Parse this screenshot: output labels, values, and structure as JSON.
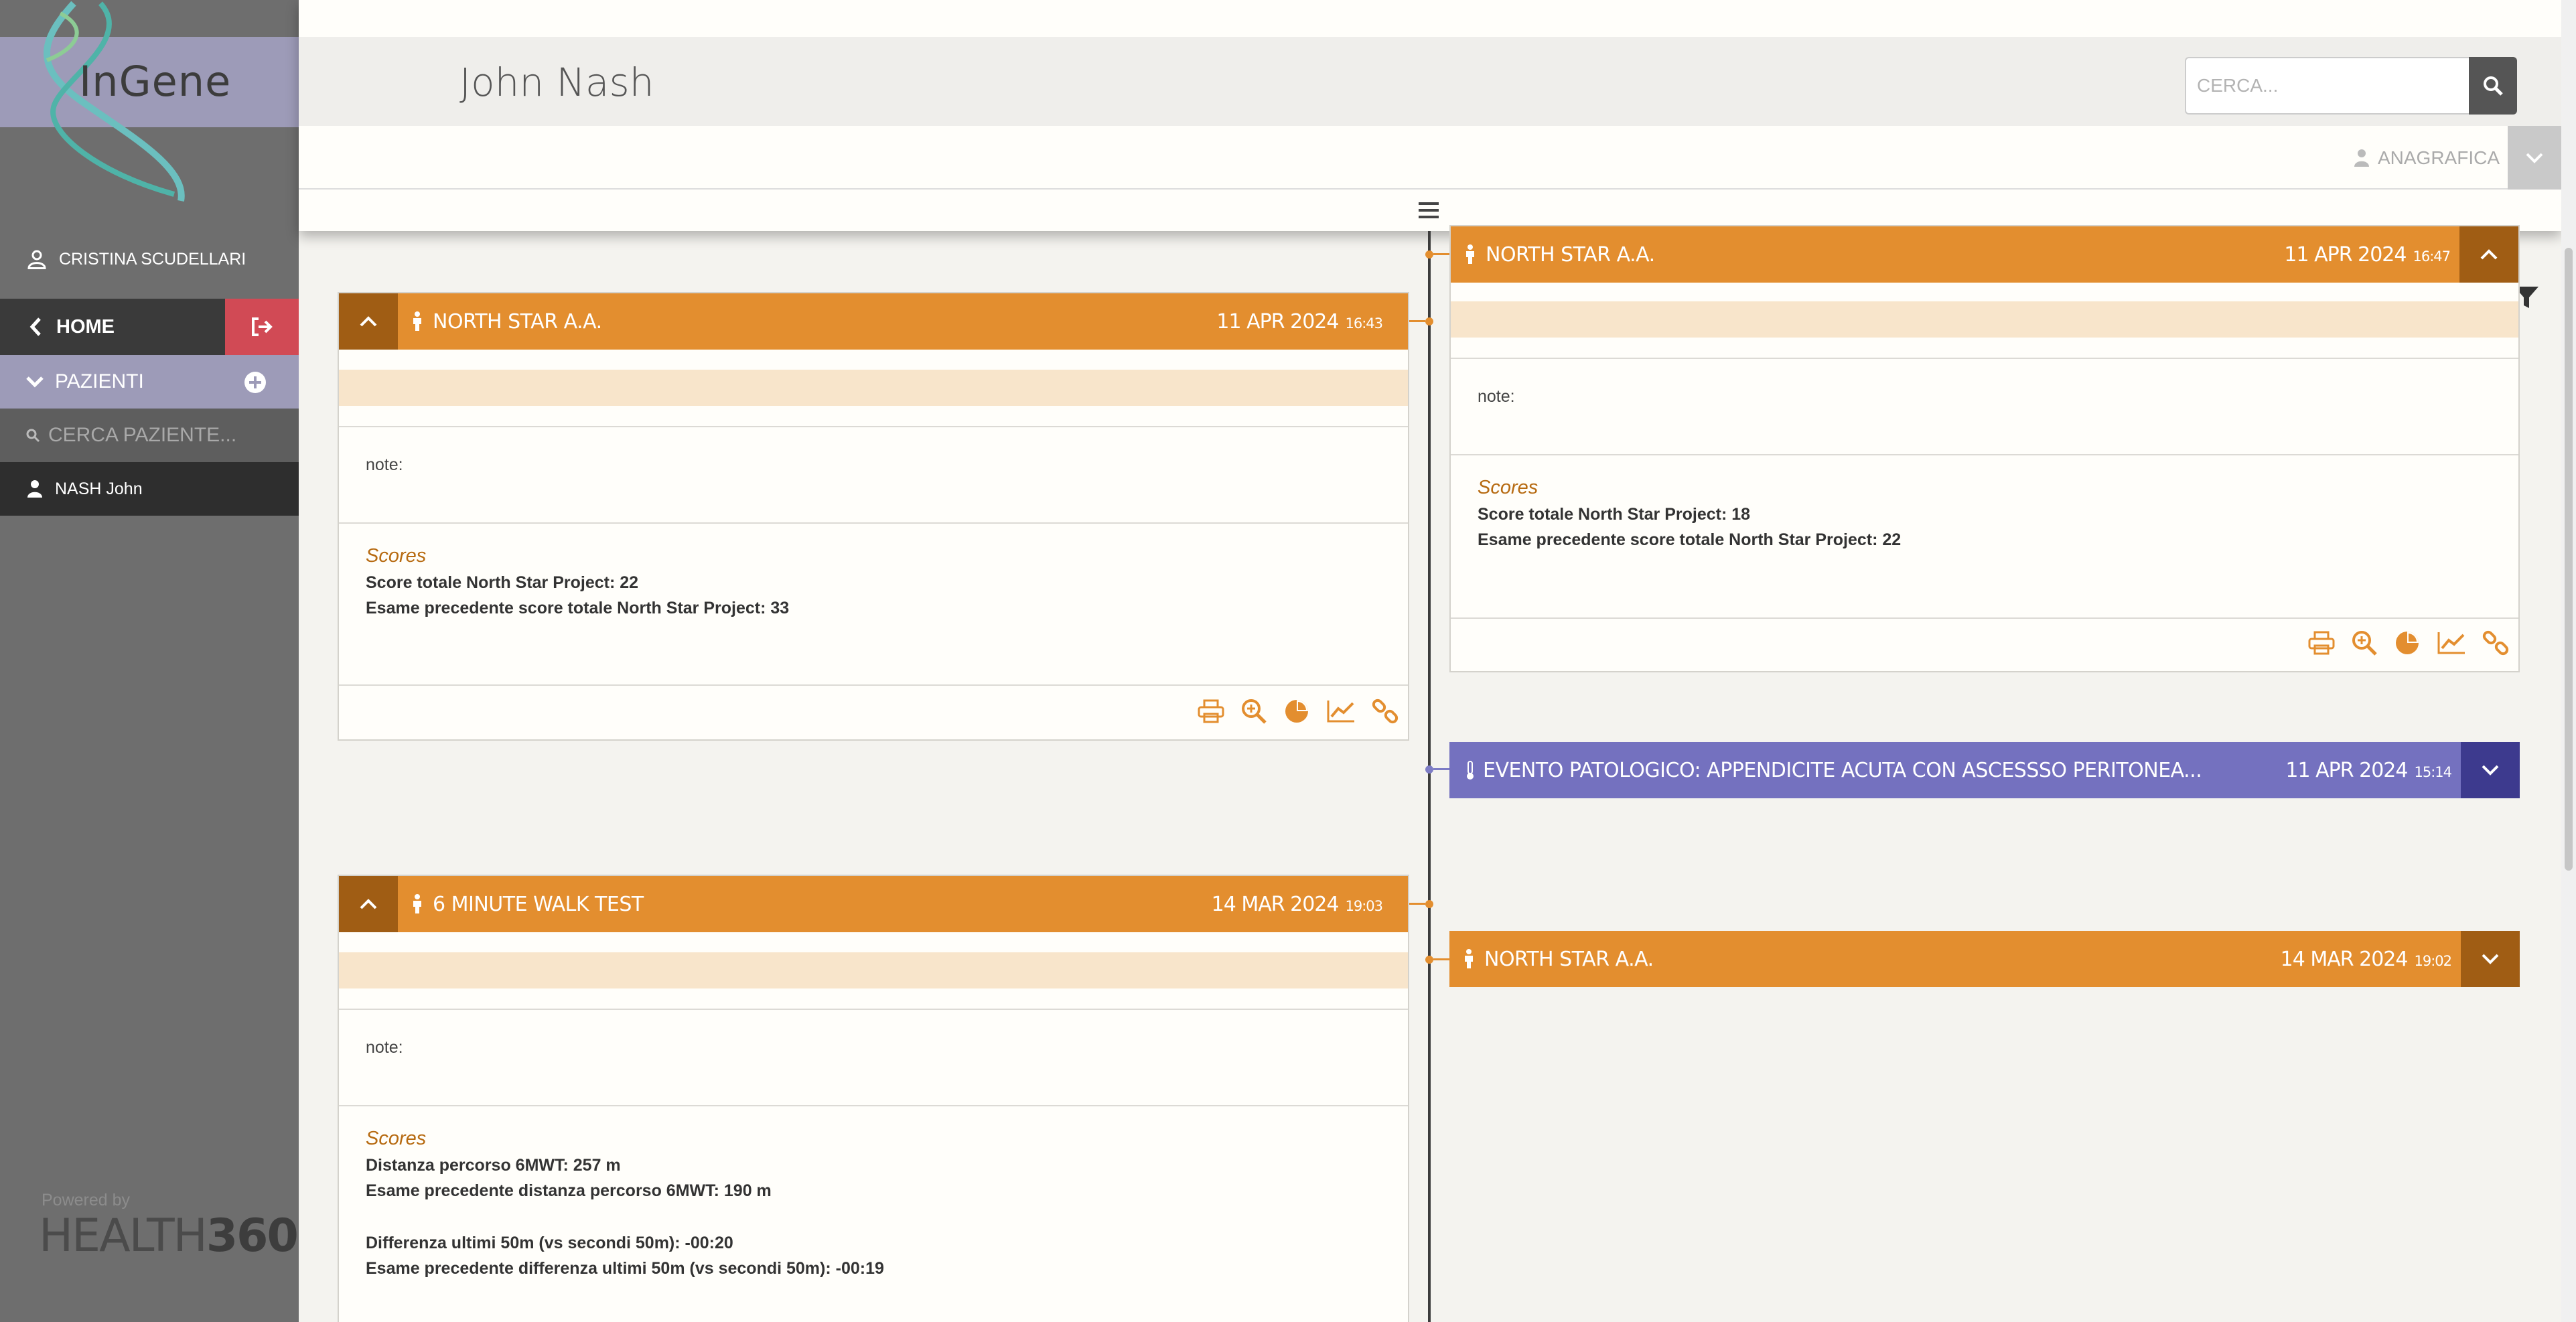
{
  "app": {
    "brand": "InGene",
    "powered_by": "Powered by",
    "vendor_a": "HEALTH",
    "vendor_b": "360"
  },
  "sidebar": {
    "user_name": "CRISTINA SCUDELLARI",
    "home_label": "HOME",
    "patients_label": "PAZIENTI",
    "search_placeholder": "CERCA PAZIENTE...",
    "patient_item": "NASH John"
  },
  "header": {
    "patient_name": "John Nash",
    "search_placeholder": "CERCA...",
    "anagrafica_label": "ANAGRAFICA"
  },
  "cards": {
    "left1": {
      "title": "NORTH STAR A.A.",
      "date": "11 APR 2024",
      "time": "16:43",
      "note_label": "note:",
      "scores_label": "Scores",
      "line1": "Score totale North Star Project: 22",
      "line2": "Esame precedente score totale North Star Project: 33"
    },
    "right1": {
      "title": "NORTH STAR A.A.",
      "date": "11 APR 2024",
      "time": "16:47",
      "note_label": "note:",
      "scores_label": "Scores",
      "line1": "Score totale North Star Project: 18",
      "line2": "Esame precedente score totale North Star Project: 22"
    },
    "event": {
      "title": "EVENTO PATOLOGICO: APPENDICITE ACUTA CON ASCESSSO PERITONEA...",
      "date": "11 APR 2024",
      "time": "15:14"
    },
    "left2": {
      "title": "6 MINUTE WALK TEST",
      "date": "14 MAR 2024",
      "time": "19:03",
      "note_label": "note:",
      "scores_label": "Scores",
      "line1": "Distanza percorso 6MWT: 257 m",
      "line2": "Esame precedente distanza percorso 6MWT: 190 m",
      "line3": "Differenza ultimi 50m (vs secondi 50m): -00:20",
      "line4": "Esame precedente differenza ultimi 50m (vs secondi 50m): -00:19"
    },
    "right2": {
      "title": "NORTH STAR A.A.",
      "date": "14 MAR 2024",
      "time": "19:02"
    }
  },
  "colors": {
    "accent_orange": "#e38e2f",
    "event_purple": "#7471bf",
    "logout_red": "#d14a55",
    "sidebar_purple": "#9d9bb8"
  },
  "icons": [
    "user-icon",
    "chevron-left-icon",
    "logout-icon",
    "chevron-down-icon",
    "plus-circle-icon",
    "search-icon",
    "patient-icon",
    "hamburger-icon",
    "walker-icon",
    "print-icon",
    "zoom-icon",
    "pie-chart-icon",
    "line-chart-icon",
    "link-icon",
    "filter-icon",
    "thermometer-icon",
    "chevron-up-icon"
  ]
}
